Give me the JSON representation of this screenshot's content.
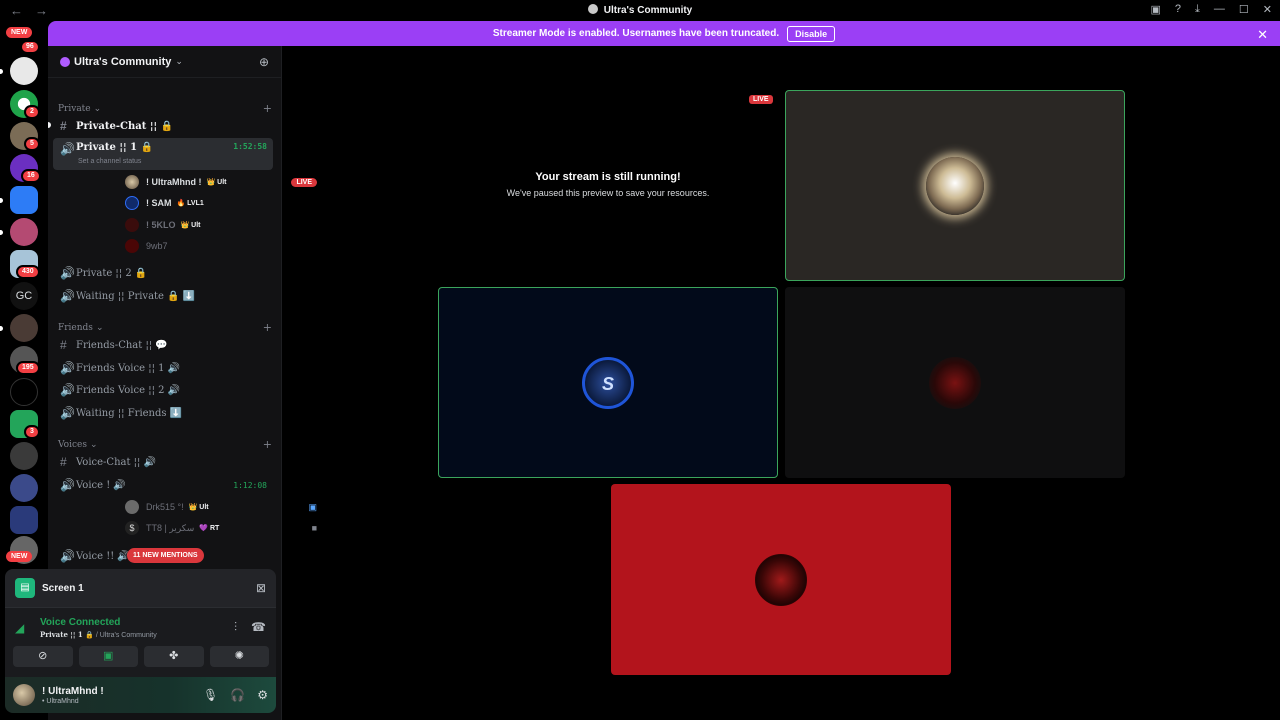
{
  "window": {
    "title": "Ultra's Community"
  },
  "banner": {
    "text": "Streamer Mode is enabled. Usernames have been truncated.",
    "button": "Disable"
  },
  "rail": {
    "new_top": "NEW",
    "new_bottom": "NEW",
    "badges": [
      "96",
      "2",
      "5",
      "16",
      "430",
      "195",
      "3"
    ],
    "gc_label": "GC"
  },
  "server": {
    "name": "Ultra's Community"
  },
  "categories": {
    "private": "Private",
    "friends": "Friends",
    "voices": "Voices"
  },
  "channels": {
    "private_chat": "Private-Chat ¦¦ 🔒",
    "private_1": "Private ¦¦ 1 🔒",
    "private_1_time": "1:52:58",
    "private_1_status": "Set a channel status",
    "private_2": "Private ¦¦ 2 🔒",
    "waiting_private": "Waiting ¦¦ Private 🔒 ⬇️",
    "friends_chat": "Friends-Chat ¦¦ 💬",
    "friends_voice_1": "Friends Voice ¦¦ 1 🔊",
    "friends_voice_2": "Friends Voice ¦¦ 2 🔊",
    "waiting_friends": "Waiting ¦¦ Friends ⬇️",
    "voice_chat": "Voice-Chat ¦¦ 🔊",
    "voice_1": "Voice ! 🔊",
    "voice_1_time": "1:12:08",
    "voice_2": "Voice !! 🔊"
  },
  "users": [
    {
      "name": "! UltraMhnd !",
      "tag": "👑 Ult",
      "live": "LIVE"
    },
    {
      "name": "! SAM",
      "tag": "🔥 LVL1"
    },
    {
      "name": "! 5KLO",
      "tag": "👑 Ult"
    },
    {
      "name": "9wb7",
      "tag": ""
    },
    {
      "name": "Drk515 °!",
      "tag": "👑 Ult"
    },
    {
      "name": "TT8 | سكرير",
      "tag": "💜 RT"
    }
  ],
  "mentions": "11 NEW MENTIONS",
  "screen_panel": {
    "label": "Screen 1"
  },
  "voice_panel": {
    "status": "Voice Connected",
    "channel": "Private ¦¦ 1 🔒",
    "server": "/ Ultra's Community"
  },
  "user_panel": {
    "name": "! UltraMhnd !",
    "sub": "• UltraMhnd"
  },
  "stage": {
    "title": "Your stream is still running!",
    "subtitle": "We've paused this preview to save your resources.",
    "live": "LIVE",
    "tile2_letter": "S"
  },
  "colors": {
    "banner": "#9b3ff5",
    "connected": "#23a55a",
    "live": "#da373c",
    "tile_red": "#b3141c"
  }
}
